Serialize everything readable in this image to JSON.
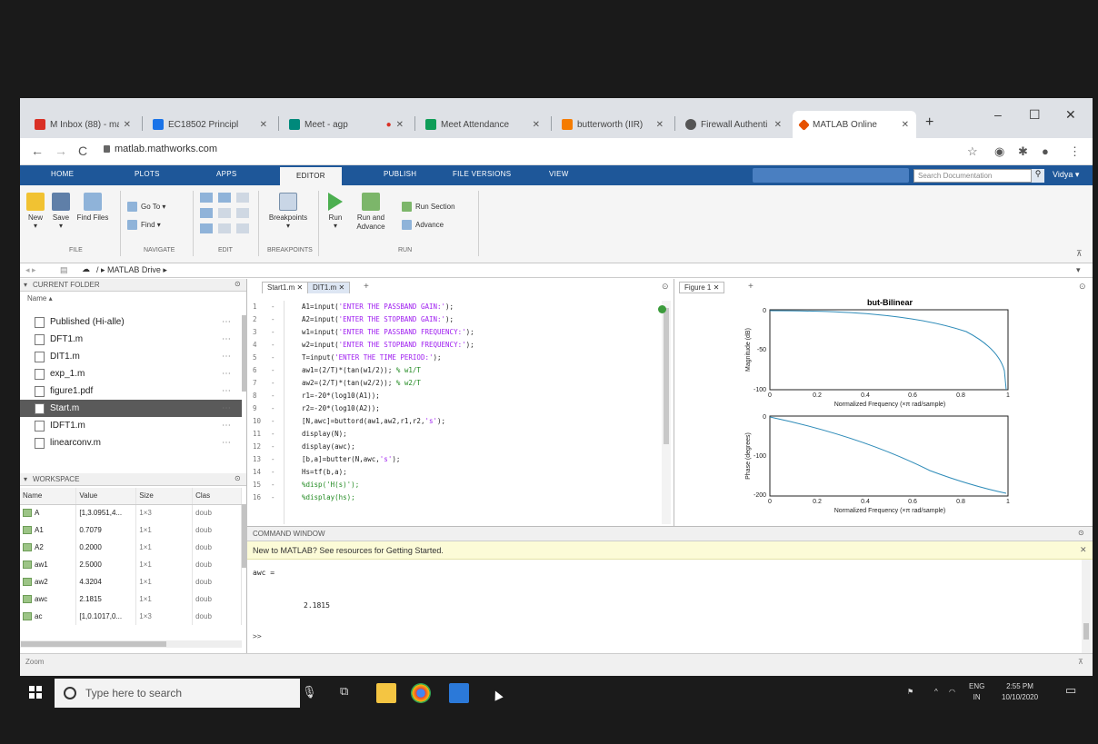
{
  "browser": {
    "tabs": [
      {
        "label": "M  Inbox (88) - mail",
        "fav": "#d93025"
      },
      {
        "label": "EC18502 Principl",
        "fav": "#1a73e8"
      },
      {
        "label": "Meet - agp",
        "fav": "#00897b"
      },
      {
        "label": "Meet Attendance",
        "fav": "#0f9d58"
      },
      {
        "label": "butterworth (IIR)",
        "fav": "#f57c00"
      },
      {
        "label": "Firewall Authenti",
        "fav": "#555555"
      },
      {
        "label": "MATLAB Online",
        "fav": "#e65100"
      }
    ],
    "new_tab": "+",
    "url": "matlab.mathworks.com",
    "window_controls": [
      "–",
      "☐",
      "✕"
    ]
  },
  "toolstrip": {
    "tabs": [
      "HOME",
      "PLOTS",
      "APPS",
      "EDITOR",
      "PUBLISH",
      "FILE VERSIONS",
      "VIEW"
    ],
    "search_placeholder": "Search Documentation",
    "user": "Vidya ▾"
  },
  "ribbon": {
    "file": {
      "new": "New",
      "save": "Save",
      "find_files": "Find Files",
      "group": "FILE"
    },
    "navigate": {
      "goto": "Go To ▾",
      "find": "Find ▾",
      "group": "NAVIGATE"
    },
    "edit": {
      "group": "EDIT"
    },
    "breakpoints": {
      "label": "Breakpoints",
      "group": "BREAKPOINTS"
    },
    "run": {
      "run": "Run",
      "run_advance": "Run and Advance",
      "run_section": "Run Section",
      "advance": "Advance",
      "group": "RUN"
    }
  },
  "pathbar": {
    "path": "/  ▸  MATLAB Drive  ▸"
  },
  "current_folder": {
    "title": "CURRENT FOLDER",
    "name_col": "Name ▴",
    "items": [
      {
        "name": "Published (Hi-alle)",
        "selected": false
      },
      {
        "name": "DFT1.m",
        "selected": false
      },
      {
        "name": "DIT1.m",
        "selected": false
      },
      {
        "name": "exp_1.m",
        "selected": false
      },
      {
        "name": "figure1.pdf",
        "selected": false
      },
      {
        "name": "Start.m",
        "selected": true
      },
      {
        "name": "IDFT1.m",
        "selected": false
      },
      {
        "name": "linearconv.m",
        "selected": false
      }
    ]
  },
  "workspace": {
    "title": "WORKSPACE",
    "columns": [
      "Name",
      "Value",
      "Size",
      "Clas"
    ],
    "rows": [
      [
        "A",
        "[1,3.0951,4...",
        "1×3",
        "doub"
      ],
      [
        "A1",
        "0.7079",
        "1×1",
        "doub"
      ],
      [
        "A2",
        "0.2000",
        "1×1",
        "doub"
      ],
      [
        "aw1",
        "2.5000",
        "1×1",
        "doub"
      ],
      [
        "aw2",
        "4.3204",
        "1×1",
        "doub"
      ],
      [
        "awc",
        "2.1815",
        "1×1",
        "doub"
      ],
      [
        "ac",
        "[1,0.1017,0...",
        "1×3",
        "doub"
      ]
    ]
  },
  "editor": {
    "tabs": [
      "Start1.m",
      "DIT1.m"
    ],
    "lines": [
      {
        "n": "1",
        "pre": "A1=input(",
        "str": "'ENTER THE PASSBAND GAIN:'",
        "post": ");"
      },
      {
        "n": "2",
        "pre": "A2=input(",
        "str": "'ENTER THE STOPBAND GAIN:'",
        "post": ");"
      },
      {
        "n": "3",
        "pre": "w1=input(",
        "str": "'ENTER THE PASSBAND FREQUENCY:'",
        "post": ");"
      },
      {
        "n": "4",
        "pre": "w2=input(",
        "str": "'ENTER THE STOPBAND FREQUENCY:'",
        "post": ");"
      },
      {
        "n": "5",
        "pre": "T=input(",
        "str": "'ENTER THE TIME PERIOD:'",
        "post": ");"
      },
      {
        "n": "6",
        "pre": "aw1=(2/T)*(tan(w1/2)); ",
        "str": "",
        "post": "",
        "cmt": "% w1/T"
      },
      {
        "n": "7",
        "pre": "aw2=(2/T)*(tan(w2/2)); ",
        "str": "",
        "post": "",
        "cmt": "% w2/T"
      },
      {
        "n": "8",
        "pre": "r1=-20*(log10(A1));",
        "str": "",
        "post": ""
      },
      {
        "n": "9",
        "pre": "r2=-20*(log10(A2));",
        "str": "",
        "post": ""
      },
      {
        "n": "10",
        "pre": "[N,awc]=buttord(aw1,aw2,r1,r2,",
        "str": "'s'",
        "post": ");"
      },
      {
        "n": "11",
        "pre": "display(N);",
        "str": "",
        "post": ""
      },
      {
        "n": "12",
        "pre": "display(awc);",
        "str": "",
        "post": ""
      },
      {
        "n": "13",
        "pre": "[b,a]=butter(N,awc,",
        "str": "'s'",
        "post": ");"
      },
      {
        "n": "14",
        "pre": "Hs=tf(b,a);",
        "str": "",
        "post": ""
      },
      {
        "n": "15",
        "pre": "%disp('H(s)');",
        "str": "",
        "post": ""
      },
      {
        "n": "16",
        "pre": "%display(hs);",
        "str": "",
        "post": ""
      }
    ]
  },
  "figure": {
    "tab": "Figure 1",
    "mag_plot": {
      "title": "but-Bilinear",
      "ylabel": "Magnitude (dB)",
      "xlabel": "Normalized Frequency  (×π rad/sample)",
      "yticks": [
        "0",
        "-50",
        "-100"
      ],
      "xticks": [
        "0",
        "0.2",
        "0.4",
        "0.6",
        "0.8",
        "1"
      ]
    },
    "phase_plot": {
      "ylabel": "Phase (degrees)",
      "xlabel": "Normalized Frequency  (×π rad/sample)",
      "yticks": [
        "0",
        "-100",
        "-200"
      ],
      "xticks": [
        "0",
        "0.2",
        "0.4",
        "0.6",
        "0.8",
        "1"
      ]
    }
  },
  "command_window": {
    "title": "COMMAND WINDOW",
    "banner": "New to MATLAB? See resources for Getting Started.",
    "var_line": "awc =",
    "value_line": "2.1815",
    "prompt": ">>"
  },
  "statusbar": {
    "text": "Zoom"
  },
  "taskbar": {
    "search": "Type here to search",
    "lang": "ENG\nIN",
    "time": "2:55 PM",
    "date": "10/10/2020"
  }
}
